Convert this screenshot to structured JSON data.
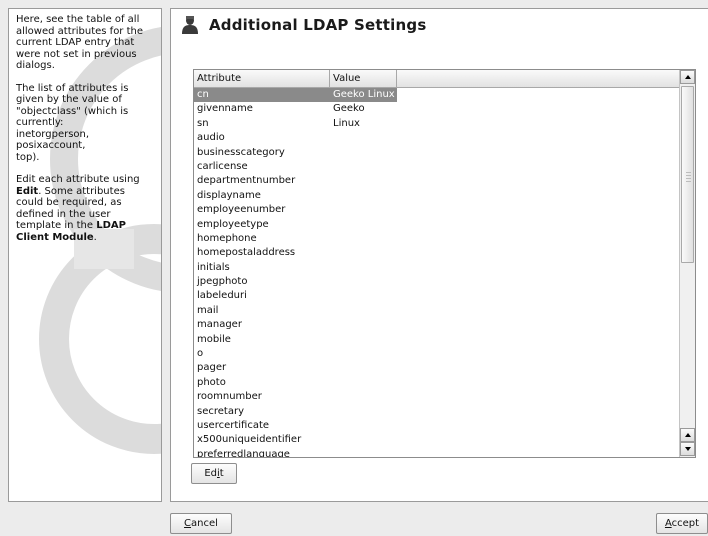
{
  "help": {
    "p1": "Here, see the table of all allowed attributes for the current LDAP entry that were not set in previous dialogs.",
    "p2_lines": [
      "The list of attributes is",
      "given by the value of",
      "\"objectclass\" (which is",
      "currently:",
      "inetorgperson,",
      "posixaccount,",
      "top)."
    ],
    "p3_pre": "Edit each attribute using ",
    "p3_edit": "Edit",
    "p3_mid": ". Some attributes could be required, as defined in the user template in the ",
    "p3_module": "LDAP Client Module",
    "p3_post": "."
  },
  "header": {
    "title": "Additional LDAP Settings",
    "icon": "user-icon"
  },
  "table": {
    "columns": [
      "Attribute",
      "Value"
    ],
    "rows": [
      {
        "attribute": "cn",
        "value": "Geeko Linux",
        "selected": true
      },
      {
        "attribute": "givenname",
        "value": "Geeko"
      },
      {
        "attribute": "sn",
        "value": "Linux"
      },
      {
        "attribute": "audio",
        "value": ""
      },
      {
        "attribute": "businesscategory",
        "value": ""
      },
      {
        "attribute": "carlicense",
        "value": ""
      },
      {
        "attribute": "departmentnumber",
        "value": ""
      },
      {
        "attribute": "displayname",
        "value": ""
      },
      {
        "attribute": "employeenumber",
        "value": ""
      },
      {
        "attribute": "employeetype",
        "value": ""
      },
      {
        "attribute": "homephone",
        "value": ""
      },
      {
        "attribute": "homepostaladdress",
        "value": ""
      },
      {
        "attribute": "initials",
        "value": ""
      },
      {
        "attribute": "jpegphoto",
        "value": ""
      },
      {
        "attribute": "labeleduri",
        "value": ""
      },
      {
        "attribute": "mail",
        "value": ""
      },
      {
        "attribute": "manager",
        "value": ""
      },
      {
        "attribute": "mobile",
        "value": ""
      },
      {
        "attribute": "o",
        "value": ""
      },
      {
        "attribute": "pager",
        "value": ""
      },
      {
        "attribute": "photo",
        "value": ""
      },
      {
        "attribute": "roomnumber",
        "value": ""
      },
      {
        "attribute": "secretary",
        "value": ""
      },
      {
        "attribute": "usercertificate",
        "value": ""
      },
      {
        "attribute": "x500uniqueidentifier",
        "value": ""
      },
      {
        "attribute": "preferredlanguage",
        "value": ""
      }
    ]
  },
  "buttons": {
    "edit": {
      "pre": "Ed",
      "mnemonic": "i",
      "post": "t"
    },
    "cancel": {
      "pre": "",
      "mnemonic": "C",
      "post": "ancel"
    },
    "accept": {
      "pre": "",
      "mnemonic": "A",
      "post": "ccept"
    }
  },
  "colors": {
    "selection": "#8a8a8a",
    "watermark": "#dcdcdc"
  }
}
